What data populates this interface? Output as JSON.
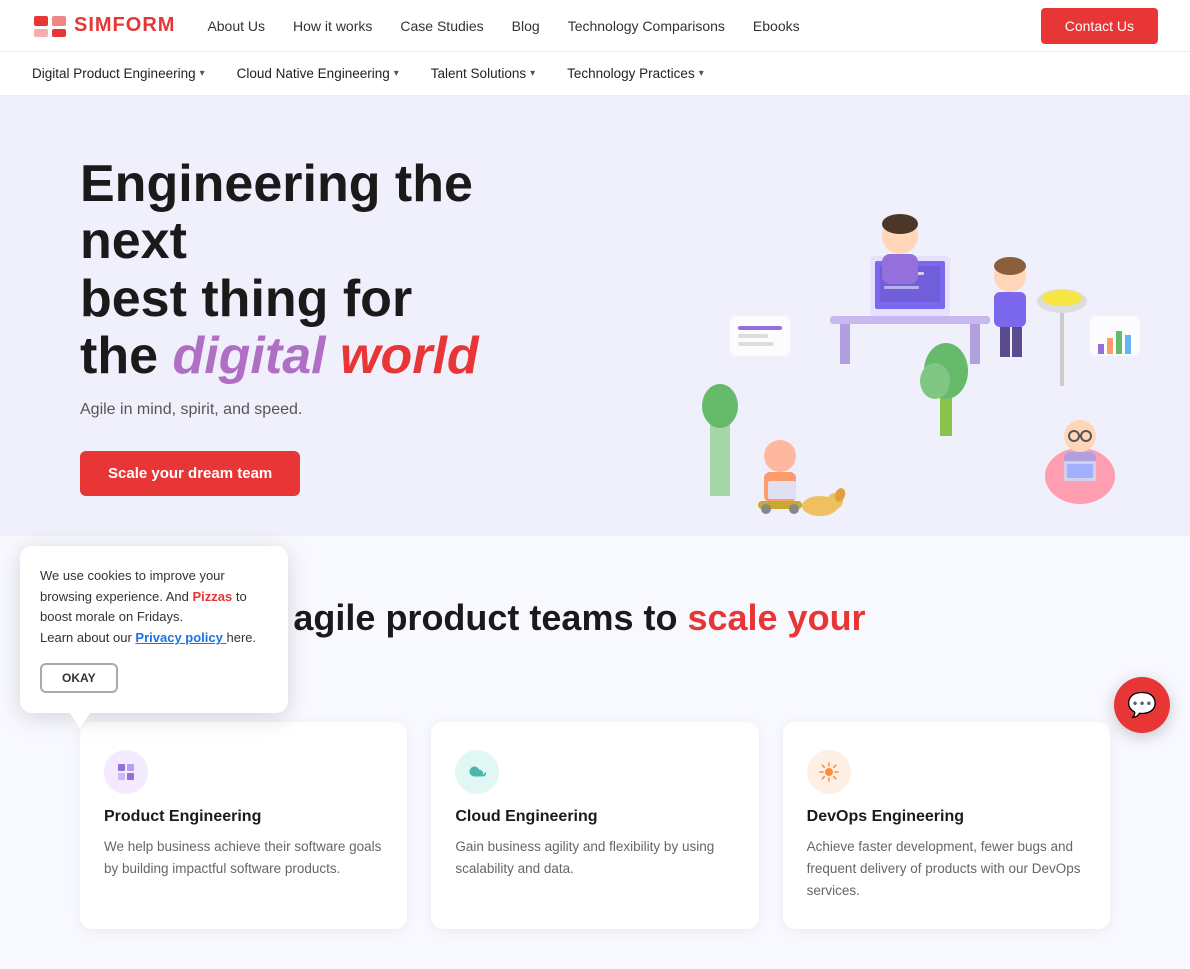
{
  "logo": {
    "text": "SIMFORM"
  },
  "topNav": {
    "links": [
      {
        "id": "about-us",
        "label": "About Us"
      },
      {
        "id": "how-it-works",
        "label": "How it works"
      },
      {
        "id": "case-studies",
        "label": "Case Studies"
      },
      {
        "id": "blog",
        "label": "Blog"
      },
      {
        "id": "technology-comparisons",
        "label": "Technology Comparisons"
      },
      {
        "id": "ebooks",
        "label": "Ebooks"
      }
    ],
    "ctaLabel": "Contact Us"
  },
  "subNav": {
    "items": [
      {
        "id": "digital-product",
        "label": "Digital Product Engineering",
        "hasDropdown": true
      },
      {
        "id": "cloud-native",
        "label": "Cloud Native Engineering",
        "hasDropdown": true
      },
      {
        "id": "talent-solutions",
        "label": "Talent Solutions",
        "hasDropdown": true
      },
      {
        "id": "technology-practices",
        "label": "Technology Practices",
        "hasDropdown": true
      }
    ]
  },
  "hero": {
    "title_line1": "Engineering the next",
    "title_line2": "best thing for",
    "title_line3_plain": "the",
    "title_line3_light": "digital",
    "title_line3_accent": "world",
    "subtitle": "Agile in mind, spirit, and speed.",
    "ctaLabel": "Scale your dream team"
  },
  "sectionTitle": {
    "line1": "World-class agile product teams to scale your business",
    "accent": "scale your business"
  },
  "cards": [
    {
      "id": "product-engineering",
      "iconColor": "purple",
      "iconGlyph": "🔷",
      "title": "Product Engineering",
      "description": "We help business achieve their software goals by building impactful software products."
    },
    {
      "id": "cloud-engineering",
      "iconColor": "teal",
      "iconGlyph": "☁️",
      "title": "Cloud Engineering",
      "description": "Gain business agility and flexibility by using scalability and data."
    },
    {
      "id": "devops-engineering",
      "iconColor": "orange",
      "iconGlyph": "⚙️",
      "title": "DevOps Engineering",
      "description": "Achieve faster development, fewer bugs and frequent delivery of products with our DevOps services."
    }
  ],
  "cookieBanner": {
    "text1": "We use cookies to improve your browsing experience. And",
    "pizzaText": "Pizzas",
    "text2": "to boost morale on Fridays.",
    "linkText": "Learn about our",
    "privacyText": "Privacy policy",
    "linkSuffix": "here.",
    "okayLabel": "OKAY"
  },
  "chatWidget": {
    "icon": "💬"
  }
}
